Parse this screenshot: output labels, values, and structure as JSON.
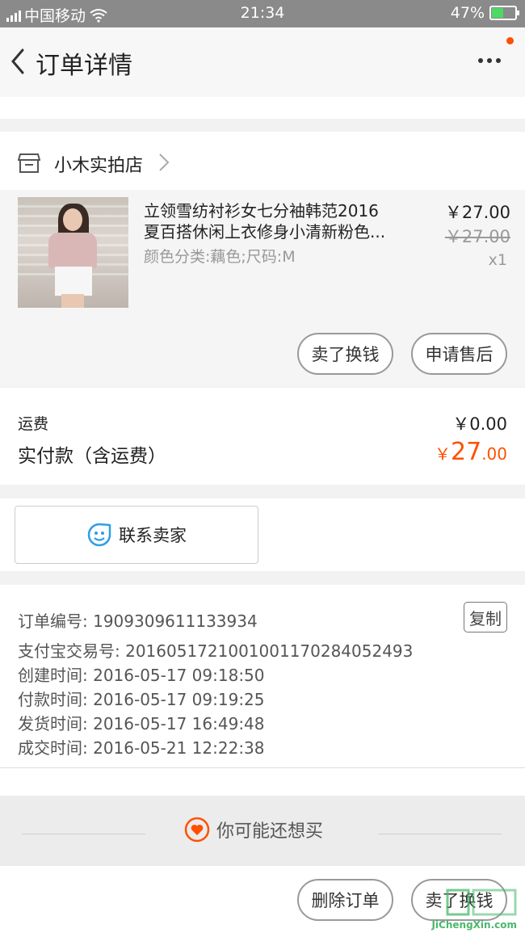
{
  "status_bar": {
    "carrier": "中国移动",
    "time": "21:34",
    "battery": "47%",
    "battery_level": 0.47
  },
  "header": {
    "title": "订单详情"
  },
  "shop": {
    "name": "小木实拍店"
  },
  "item": {
    "title_line1": "立领雪纺衬衫女七分袖韩范2016",
    "title_line2": "夏百搭休闲上衣修身小清新粉色...",
    "spec": "颜色分类:藕色;尺码:M",
    "price": "￥27.00",
    "original_price": "￥27.00",
    "quantity": "x1",
    "actions": {
      "sell": "卖了换钱",
      "after_sale": "申请售后"
    }
  },
  "payment": {
    "shipping_label": "运费",
    "shipping_value": "￥0.00",
    "total_label": "实付款（含运费）",
    "total_currency": "￥",
    "total_int": "27",
    "total_dec": ".00"
  },
  "contact": {
    "label": "联系卖家"
  },
  "order_info": {
    "order_number": "订单编号: 1909309611133934",
    "copy_label": "复制",
    "alipay_number": "支付宝交易号: 2016051721001001170284052493",
    "created": "创建时间: 2016-05-17 09:18:50",
    "paid": "付款时间: 2016-05-17 09:19:25",
    "shipped": "发货时间: 2016-05-17 16:49:48",
    "completed": "成交时间: 2016-05-21 12:22:38"
  },
  "recommend": {
    "label": "你可能还想买"
  },
  "bottom_bar": {
    "delete_label": "删除订单",
    "sell_label": "卖了换钱"
  },
  "watermark": {
    "text": "JiChengXin.com"
  },
  "colors": {
    "accent": "#ff5000",
    "status_bar": "#8a8a8a",
    "border": "#999999"
  },
  "icons": [
    "signal-icon",
    "wifi-icon",
    "battery-icon",
    "back-icon",
    "more-icon",
    "shop-icon",
    "chevron-right-icon",
    "smile-chat-icon",
    "heart-icon"
  ]
}
